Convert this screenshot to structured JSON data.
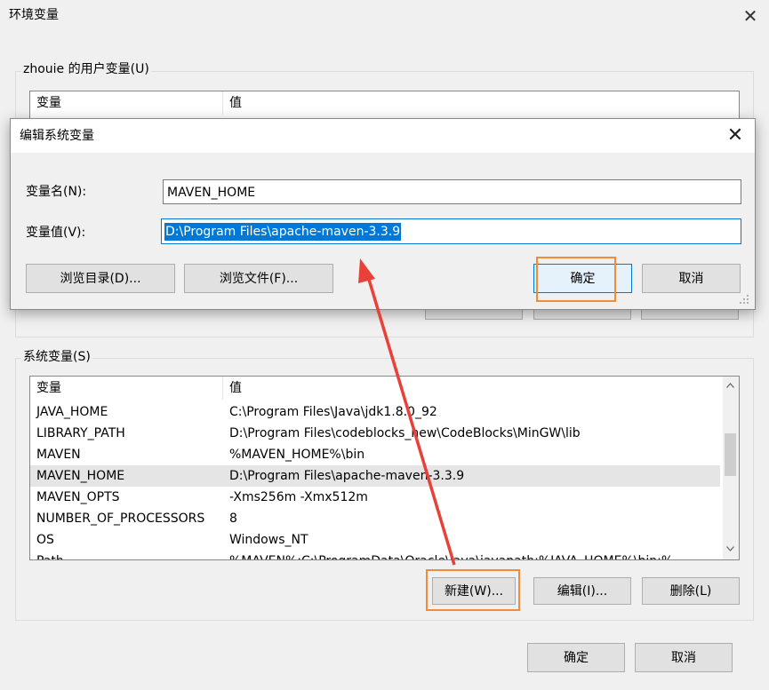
{
  "window": {
    "title": "环境变量",
    "close_glyph": "✕"
  },
  "user_vars": {
    "group_label": "zhouie 的用户变量(U)",
    "columns": [
      "变量",
      "值"
    ]
  },
  "system_vars": {
    "group_label": "系统变量(S)",
    "columns": [
      "变量",
      "值"
    ],
    "rows": [
      {
        "name": "JAVA_HOME",
        "value": "C:\\Program Files\\Java\\jdk1.8.0_92"
      },
      {
        "name": "LIBRARY_PATH",
        "value": "D:\\Program Files\\codeblocks_new\\CodeBlocks\\MinGW\\lib"
      },
      {
        "name": "MAVEN",
        "value": "%MAVEN_HOME%\\bin"
      },
      {
        "name": "MAVEN_HOME",
        "value": "D:\\Program Files\\apache-maven-3.3.9"
      },
      {
        "name": "MAVEN_OPTS",
        "value": "-Xms256m -Xmx512m"
      },
      {
        "name": "NUMBER_OF_PROCESSORS",
        "value": "8"
      },
      {
        "name": "OS",
        "value": "Windows_NT"
      },
      {
        "name": "Path",
        "value": "%MAVEN%;C:\\ProgramData\\Oracle\\Java\\javapath;%JAVA_HOME%\\bin;%..."
      }
    ],
    "selected_index": 3,
    "buttons": {
      "new": "新建(W)...",
      "edit": "编辑(I)...",
      "delete": "删除(L)"
    }
  },
  "footer": {
    "ok": "确定",
    "cancel": "取消"
  },
  "dialog": {
    "title": "编辑系统变量",
    "close_glyph": "✕",
    "name_label": "变量名(N):",
    "name_value": "MAVEN_HOME",
    "value_label": "变量值(V):",
    "value_value": "D:\\Program Files\\apache-maven-3.3.9",
    "buttons": {
      "browse_dir": "浏览目录(D)...",
      "browse_file": "浏览文件(F)...",
      "ok": "确定",
      "cancel": "取消"
    }
  },
  "icons": {
    "close": "close-icon",
    "scroll_up": "scroll-up-arrow",
    "scroll_down": "scroll-down-arrow",
    "resize_grip": "resize-grip-icon"
  },
  "colors": {
    "annotation_orange": "#f08c3a",
    "annotation_red_arrow": "#e8413a",
    "selection_blue": "#0078d7"
  }
}
